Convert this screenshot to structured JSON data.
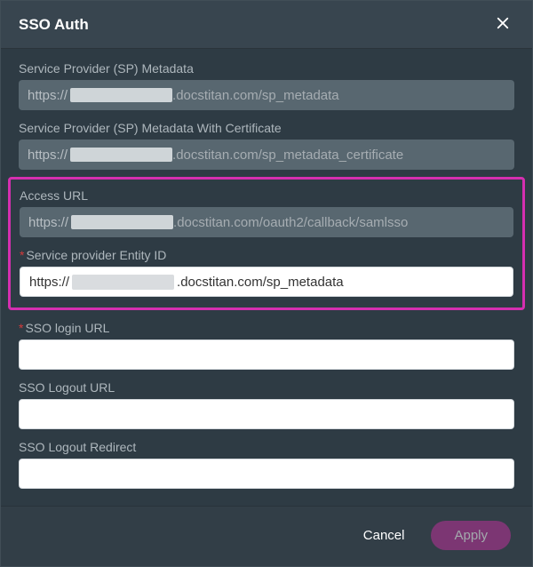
{
  "modal": {
    "title": "SSO Auth"
  },
  "fields": {
    "sp_metadata": {
      "label": "Service Provider (SP) Metadata",
      "prefix": "https://",
      "suffix": ".docstitan.com/sp_metadata"
    },
    "sp_metadata_cert": {
      "label": "Service Provider (SP) Metadata With Certificate",
      "prefix": "https://",
      "suffix": ".docstitan.com/sp_metadata_certificate"
    },
    "access_url": {
      "label": "Access URL",
      "prefix": "https://",
      "suffix": ".docstitan.com/oauth2/callback/samlsso"
    },
    "entity_id": {
      "label": "Service provider Entity ID",
      "value_prefix": "https://",
      "value_suffix": ".docstitan.com/sp_metadata"
    },
    "sso_login_url": {
      "label": "SSO login URL",
      "value": ""
    },
    "sso_logout_url": {
      "label": "SSO Logout URL",
      "value": ""
    },
    "sso_logout_redirect": {
      "label": "SSO Logout Redirect",
      "value": ""
    }
  },
  "buttons": {
    "cancel": "Cancel",
    "apply": "Apply"
  },
  "required_marker": "*"
}
